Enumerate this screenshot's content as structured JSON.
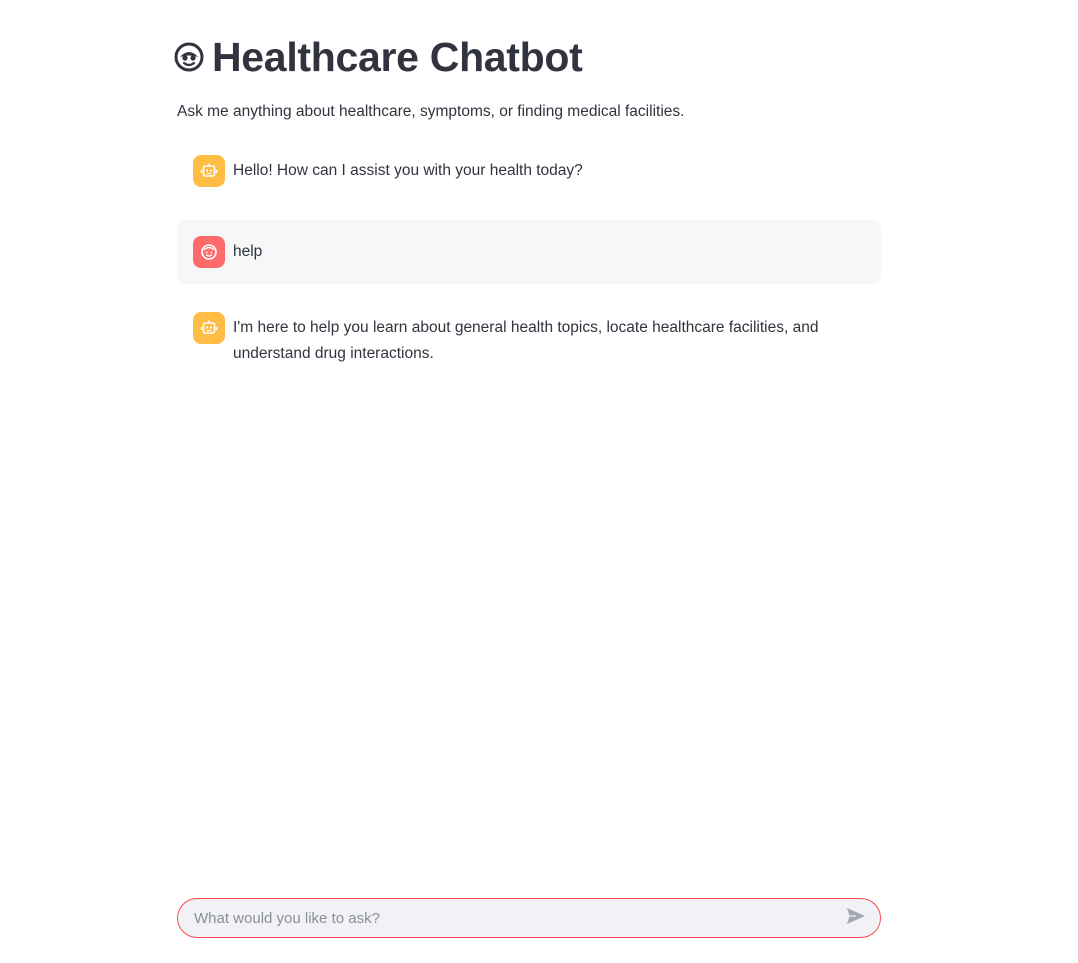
{
  "header": {
    "icon": "robot-face-icon",
    "title": "Healthcare Chatbot",
    "subtitle": "Ask me anything about healthcare, symptoms, or finding medical facilities."
  },
  "messages": [
    {
      "role": "assistant",
      "avatar_icon": "robot-icon",
      "text": "Hello! How can I assist you with your health today?"
    },
    {
      "role": "user",
      "avatar_icon": "user-face-icon",
      "text": "help"
    },
    {
      "role": "assistant",
      "avatar_icon": "robot-icon",
      "text": "I'm here to help you learn about general health topics, locate healthcare facilities, and understand drug interactions."
    }
  ],
  "chat_input": {
    "placeholder": "What would you like to ask?",
    "value": "",
    "send_icon": "send-arrow-icon"
  },
  "colors": {
    "assistant_avatar": "#ffbd45",
    "user_avatar": "#ff6b6b",
    "input_border": "#ff4b4b",
    "text": "#31333f"
  }
}
